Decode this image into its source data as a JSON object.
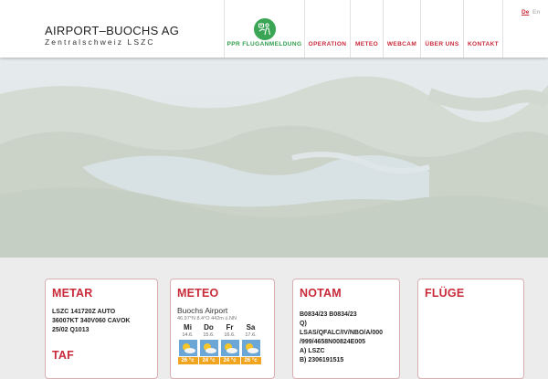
{
  "header": {
    "brand_title": "AIRPORT–BUOCHS AG",
    "brand_subtitle": "Zentralschweiz LSZC",
    "nav": [
      {
        "label": "PPR FLUGANMELDUNG"
      },
      {
        "label": "OPERATION"
      },
      {
        "label": "METEO"
      },
      {
        "label": "WEBCAM"
      },
      {
        "label": "ÜBER UNS"
      },
      {
        "label": "KONTAKT"
      }
    ],
    "languages": [
      "De",
      "En"
    ]
  },
  "cards": {
    "metar": {
      "title": "METAR",
      "lines": [
        "LSZC 141720Z AUTO",
        "36007KT 340V060 CAVOK",
        "25/02 Q1013"
      ]
    },
    "taf": {
      "title": "TAF"
    },
    "meteo": {
      "title": "METEO",
      "station": "Buochs Airport",
      "coords": "46.97°N 8.4°O 442m ü.NN",
      "days": [
        {
          "name": "Mi",
          "date": "14.6.",
          "temp": "26 °c"
        },
        {
          "name": "Do",
          "date": "15.6.",
          "temp": "24 °c"
        },
        {
          "name": "Fr",
          "date": "16.6.",
          "temp": "24 °c"
        },
        {
          "name": "Sa",
          "date": "17.6.",
          "temp": "26 °c"
        }
      ]
    },
    "notam": {
      "title": "NOTAM",
      "lines": [
        "B0834/23 B0834/23",
        "Q)",
        "LSAS/QFALC/IV/NBO/A/000",
        "/999/4658N00824E005",
        "A) LSZC",
        "B) 2306191515"
      ]
    },
    "fluge": {
      "title": "FLÜGE"
    }
  },
  "colors": {
    "accent_red": "#c92a3a",
    "accent_green": "#3aa655",
    "card_border": "#d9aeb3"
  }
}
